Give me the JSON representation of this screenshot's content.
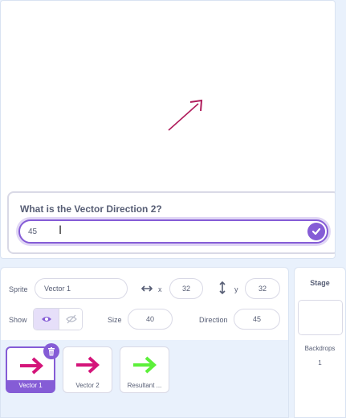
{
  "ask": {
    "question": "What is the Vector Direction 2?",
    "answer_value": "45"
  },
  "sprite_info": {
    "sprite_label": "Sprite",
    "sprite_name": "Vector 1",
    "x_label": "x",
    "x_value": "32",
    "y_label": "y",
    "y_value": "32",
    "show_label": "Show",
    "size_label": "Size",
    "size_value": "40",
    "direction_label": "Direction",
    "direction_value": "45"
  },
  "sprites": [
    {
      "name": "Vector 1",
      "color": "#d4147a",
      "selected": true
    },
    {
      "name": "Vector 2",
      "color": "#d4147a",
      "selected": false
    },
    {
      "name": "Resultant ...",
      "color": "#5cf03a",
      "selected": false
    }
  ],
  "stage_pane": {
    "title": "Stage",
    "backdrops_label": "Backdrops",
    "backdrops_count": "1"
  },
  "colors": {
    "accent": "#855cd6",
    "vector_arrow": "#d4147a",
    "resultant_arrow": "#5cf03a"
  },
  "icons": [
    "arrow-icon",
    "check-icon",
    "horizontal-arrows-icon",
    "vertical-arrows-icon",
    "eye-icon",
    "eye-slash-icon",
    "trash-icon"
  ]
}
